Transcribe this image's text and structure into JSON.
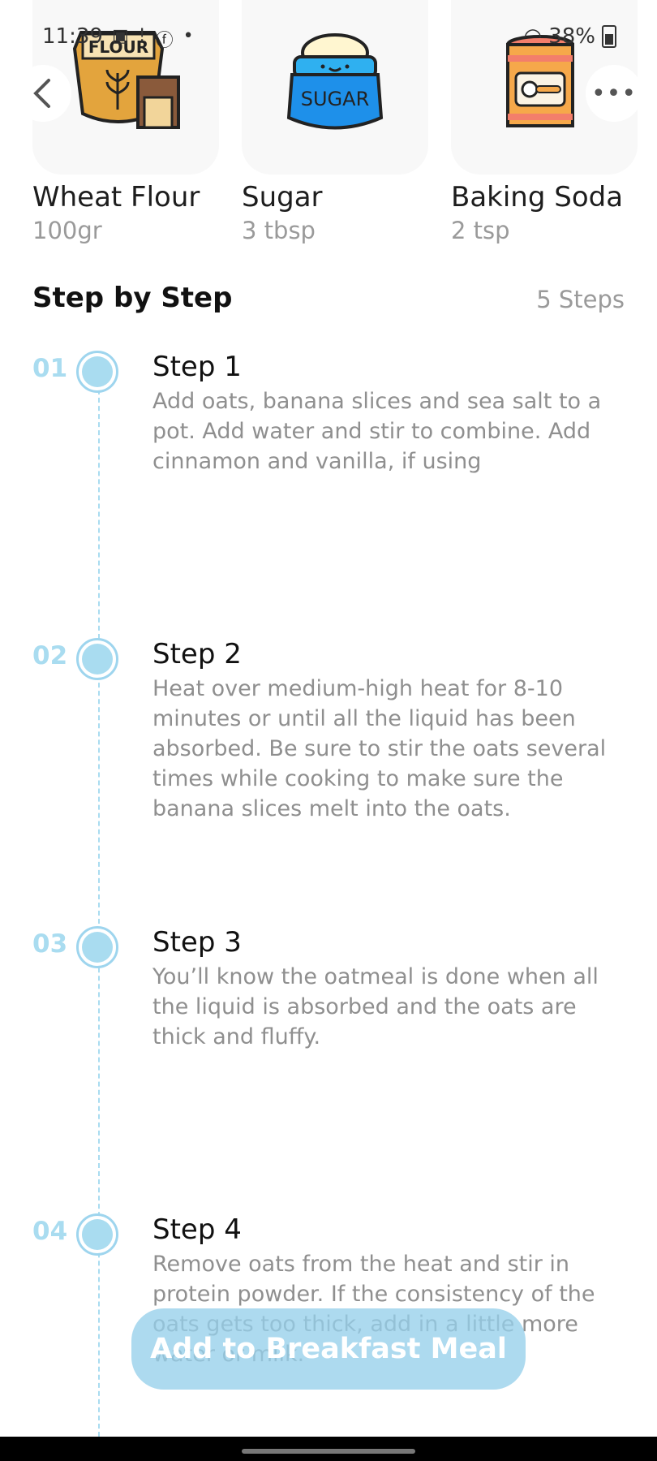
{
  "status_bar": {
    "time": "11:39",
    "battery": "38%"
  },
  "ingredients": [
    {
      "name": "Wheat Flour",
      "qty": "100gr",
      "icon": "flour-bag-icon",
      "label_on_icon": "FLOUR"
    },
    {
      "name": "Sugar",
      "qty": "3 tbsp",
      "icon": "sugar-bag-icon",
      "label_on_icon": "SUGAR"
    },
    {
      "name": "Baking Soda",
      "qty": "2 tsp",
      "icon": "baking-soda-can-icon"
    }
  ],
  "section": {
    "title": "Step by Step",
    "count": "5 Steps"
  },
  "steps": [
    {
      "num": "01",
      "title": "Step 1",
      "desc": "Add oats, banana slices and sea salt to a pot. Add water and stir to combine. Add cinnamon and vanilla, if using"
    },
    {
      "num": "02",
      "title": "Step 2",
      "desc": "Heat over medium-high heat for 8-10 minutes or until all the liquid has been absorbed. Be sure to stir the oats several times while cooking to make sure the banana slices melt into the oats."
    },
    {
      "num": "03",
      "title": "Step 3",
      "desc": "You’ll know the oatmeal is done when all the liquid is absorbed and the oats are thick and fluffy."
    },
    {
      "num": "04",
      "title": "Step 4",
      "desc": "Remove oats from the heat and stir in protein powder. If the consistency of the oats gets too thick, add in a little more water or milk."
    }
  ],
  "cta": {
    "label": "Add to Breakfast Meal"
  },
  "colors": {
    "accent": "#a9dcf0",
    "button": "#96d0eb",
    "muted_text": "#8f8f8f"
  }
}
